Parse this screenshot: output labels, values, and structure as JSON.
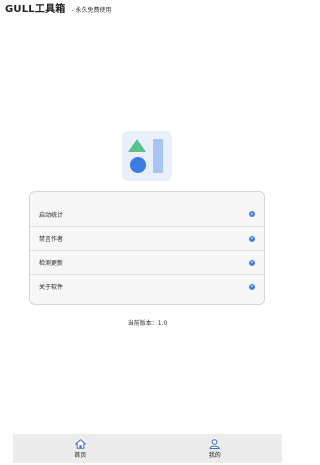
{
  "header": {
    "title": "GULL工具箱",
    "subtitle": "- 永久免费使用"
  },
  "menu": {
    "items": [
      {
        "label": "启动统计"
      },
      {
        "label": "禁言作者"
      },
      {
        "label": "检测更新"
      },
      {
        "label": "关于软件"
      }
    ]
  },
  "version": {
    "text": "当前版本：1.0"
  },
  "bottom_nav": {
    "tabs": [
      {
        "label": "首页",
        "icon": "home-icon"
      },
      {
        "label": "我的",
        "icon": "user-icon"
      }
    ]
  },
  "colors": {
    "logo_bg": "#e9f0fb",
    "logo_triangle": "#5cc28a",
    "logo_circle": "#3d7be0",
    "logo_bar": "#a8c4f2",
    "accent": "#4a7fe6"
  }
}
